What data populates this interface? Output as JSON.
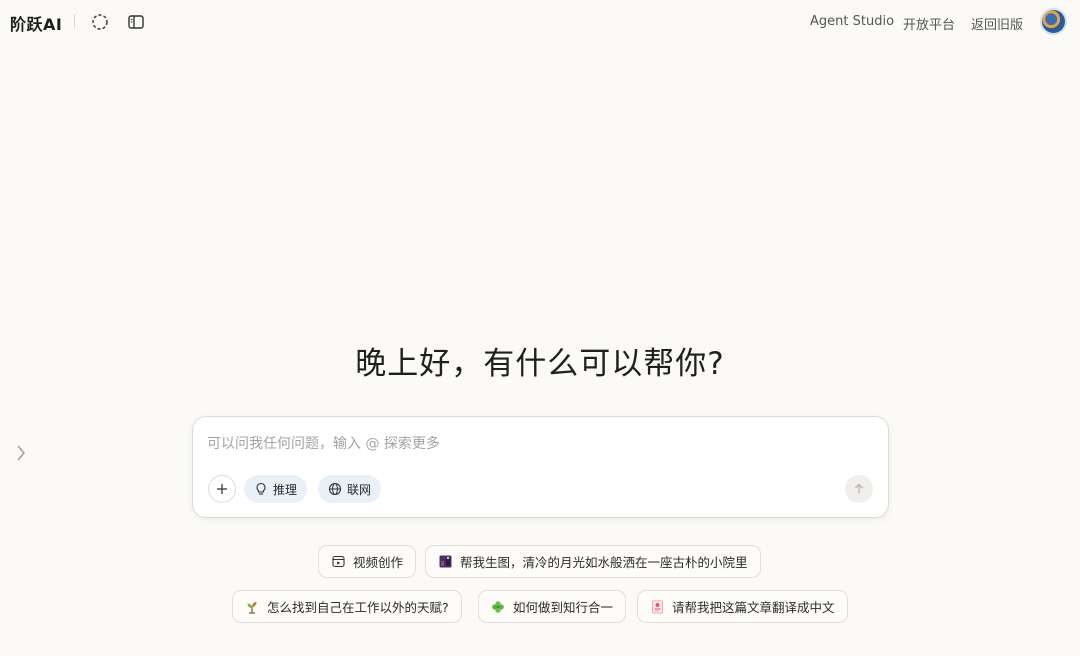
{
  "header": {
    "logo": "阶跃AI",
    "links": {
      "agent_studio": "Agent Studio",
      "open_platform": "开放平台",
      "old_version": "返回旧版"
    }
  },
  "main": {
    "greeting": "晚上好，有什么可以帮你?",
    "input": {
      "placeholder": "可以问我任何问题，输入 @ 探索更多",
      "value": ""
    },
    "chips": {
      "reasoning": "推理",
      "web": "联网"
    },
    "suggestions": [
      {
        "label": "视频创作",
        "icon": "video-icon"
      },
      {
        "label": "帮我生图，清冷的月光如水般洒在一座古朴的小院里",
        "icon": "image-thumbnail-icon"
      },
      {
        "label": "怎么找到自己在工作以外的天赋?",
        "icon": "plant-icon"
      },
      {
        "label": "如何做到知行合一",
        "icon": "clover-icon"
      },
      {
        "label": "请帮我把这篇文章翻译成中文",
        "icon": "document-icon"
      }
    ]
  },
  "colors": {
    "background": "#fbfaf6",
    "chip_bg": "#e9f0f8",
    "text": "#222222",
    "muted": "#a3a3a3"
  }
}
